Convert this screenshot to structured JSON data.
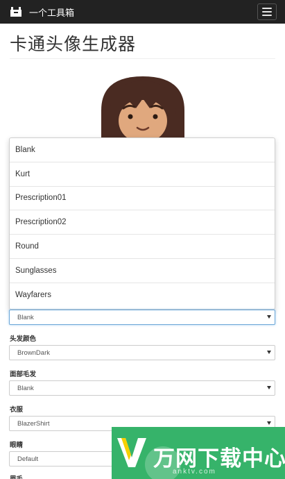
{
  "navbar": {
    "brand_icon": "toolbox-icon",
    "brand_text": "一个工具箱",
    "menu_icon": "hamburger-menu-icon"
  },
  "page": {
    "title": "卡通头像生成器"
  },
  "avatar": {
    "icon": "cartoon-avatar-preview",
    "colors": {
      "hair": "#4a2b22",
      "skin": "#e0a87e"
    }
  },
  "dropdown": {
    "options": [
      "Blank",
      "Kurt",
      "Prescription01",
      "Prescription02",
      "Round",
      "Sunglasses",
      "Wayfarers"
    ]
  },
  "form": {
    "accessories_value": "Blank",
    "hair_color_label": "头发颜色",
    "hair_color_value": "BrownDark",
    "facial_hair_label": "面部毛发",
    "facial_hair_value": "Blank",
    "clothes_label": "衣服",
    "clothes_value": "BlazerShirt",
    "eyes_label": "眼睛",
    "eyes_value": "Default",
    "eyebrow_label": "眉毛"
  },
  "banner": {
    "text": "万网下载中心",
    "domain": "anktv.com",
    "color": "#36b36a"
  }
}
